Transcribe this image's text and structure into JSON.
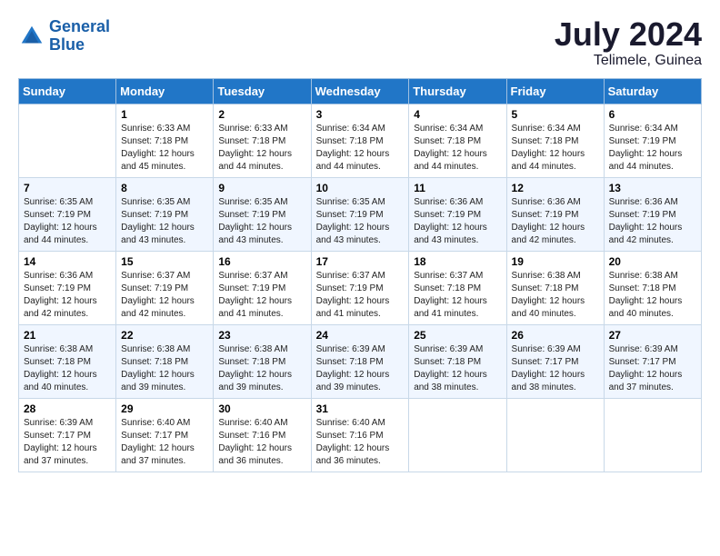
{
  "logo": {
    "line1": "General",
    "line2": "Blue"
  },
  "title": {
    "month_year": "July 2024",
    "location": "Telimele, Guinea"
  },
  "days_of_week": [
    "Sunday",
    "Monday",
    "Tuesday",
    "Wednesday",
    "Thursday",
    "Friday",
    "Saturday"
  ],
  "weeks": [
    [
      {
        "day": "",
        "info": ""
      },
      {
        "day": "1",
        "info": "Sunrise: 6:33 AM\nSunset: 7:18 PM\nDaylight: 12 hours\nand 45 minutes."
      },
      {
        "day": "2",
        "info": "Sunrise: 6:33 AM\nSunset: 7:18 PM\nDaylight: 12 hours\nand 44 minutes."
      },
      {
        "day": "3",
        "info": "Sunrise: 6:34 AM\nSunset: 7:18 PM\nDaylight: 12 hours\nand 44 minutes."
      },
      {
        "day": "4",
        "info": "Sunrise: 6:34 AM\nSunset: 7:18 PM\nDaylight: 12 hours\nand 44 minutes."
      },
      {
        "day": "5",
        "info": "Sunrise: 6:34 AM\nSunset: 7:18 PM\nDaylight: 12 hours\nand 44 minutes."
      },
      {
        "day": "6",
        "info": "Sunrise: 6:34 AM\nSunset: 7:19 PM\nDaylight: 12 hours\nand 44 minutes."
      }
    ],
    [
      {
        "day": "7",
        "info": "Sunrise: 6:35 AM\nSunset: 7:19 PM\nDaylight: 12 hours\nand 44 minutes."
      },
      {
        "day": "8",
        "info": "Sunrise: 6:35 AM\nSunset: 7:19 PM\nDaylight: 12 hours\nand 43 minutes."
      },
      {
        "day": "9",
        "info": "Sunrise: 6:35 AM\nSunset: 7:19 PM\nDaylight: 12 hours\nand 43 minutes."
      },
      {
        "day": "10",
        "info": "Sunrise: 6:35 AM\nSunset: 7:19 PM\nDaylight: 12 hours\nand 43 minutes."
      },
      {
        "day": "11",
        "info": "Sunrise: 6:36 AM\nSunset: 7:19 PM\nDaylight: 12 hours\nand 43 minutes."
      },
      {
        "day": "12",
        "info": "Sunrise: 6:36 AM\nSunset: 7:19 PM\nDaylight: 12 hours\nand 42 minutes."
      },
      {
        "day": "13",
        "info": "Sunrise: 6:36 AM\nSunset: 7:19 PM\nDaylight: 12 hours\nand 42 minutes."
      }
    ],
    [
      {
        "day": "14",
        "info": "Sunrise: 6:36 AM\nSunset: 7:19 PM\nDaylight: 12 hours\nand 42 minutes."
      },
      {
        "day": "15",
        "info": "Sunrise: 6:37 AM\nSunset: 7:19 PM\nDaylight: 12 hours\nand 42 minutes."
      },
      {
        "day": "16",
        "info": "Sunrise: 6:37 AM\nSunset: 7:19 PM\nDaylight: 12 hours\nand 41 minutes."
      },
      {
        "day": "17",
        "info": "Sunrise: 6:37 AM\nSunset: 7:19 PM\nDaylight: 12 hours\nand 41 minutes."
      },
      {
        "day": "18",
        "info": "Sunrise: 6:37 AM\nSunset: 7:18 PM\nDaylight: 12 hours\nand 41 minutes."
      },
      {
        "day": "19",
        "info": "Sunrise: 6:38 AM\nSunset: 7:18 PM\nDaylight: 12 hours\nand 40 minutes."
      },
      {
        "day": "20",
        "info": "Sunrise: 6:38 AM\nSunset: 7:18 PM\nDaylight: 12 hours\nand 40 minutes."
      }
    ],
    [
      {
        "day": "21",
        "info": "Sunrise: 6:38 AM\nSunset: 7:18 PM\nDaylight: 12 hours\nand 40 minutes."
      },
      {
        "day": "22",
        "info": "Sunrise: 6:38 AM\nSunset: 7:18 PM\nDaylight: 12 hours\nand 39 minutes."
      },
      {
        "day": "23",
        "info": "Sunrise: 6:38 AM\nSunset: 7:18 PM\nDaylight: 12 hours\nand 39 minutes."
      },
      {
        "day": "24",
        "info": "Sunrise: 6:39 AM\nSunset: 7:18 PM\nDaylight: 12 hours\nand 39 minutes."
      },
      {
        "day": "25",
        "info": "Sunrise: 6:39 AM\nSunset: 7:18 PM\nDaylight: 12 hours\nand 38 minutes."
      },
      {
        "day": "26",
        "info": "Sunrise: 6:39 AM\nSunset: 7:17 PM\nDaylight: 12 hours\nand 38 minutes."
      },
      {
        "day": "27",
        "info": "Sunrise: 6:39 AM\nSunset: 7:17 PM\nDaylight: 12 hours\nand 37 minutes."
      }
    ],
    [
      {
        "day": "28",
        "info": "Sunrise: 6:39 AM\nSunset: 7:17 PM\nDaylight: 12 hours\nand 37 minutes."
      },
      {
        "day": "29",
        "info": "Sunrise: 6:40 AM\nSunset: 7:17 PM\nDaylight: 12 hours\nand 37 minutes."
      },
      {
        "day": "30",
        "info": "Sunrise: 6:40 AM\nSunset: 7:16 PM\nDaylight: 12 hours\nand 36 minutes."
      },
      {
        "day": "31",
        "info": "Sunrise: 6:40 AM\nSunset: 7:16 PM\nDaylight: 12 hours\nand 36 minutes."
      },
      {
        "day": "",
        "info": ""
      },
      {
        "day": "",
        "info": ""
      },
      {
        "day": "",
        "info": ""
      }
    ]
  ]
}
